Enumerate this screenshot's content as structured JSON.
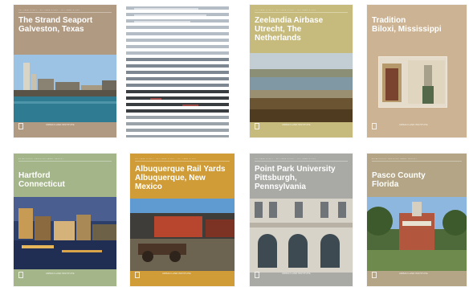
{
  "covers": [
    {
      "title": "The Strand Seaport\nGalveston, Texas",
      "series": "ULI CASE STUDY · ULI CASE STUDY · ULI CASE STUDY",
      "footer": "URBAN LAND INSTITUTE",
      "bg": "#b19a82"
    },
    {
      "title": "",
      "series": "",
      "footer": "",
      "bg": "#ffffff"
    },
    {
      "title": "Zeelandia Airbase\nUtrecht, The Netherlands",
      "series": "ULI CASE STUDY · ULI CASE STUDY · ULI CASE STUDY",
      "footer": "URBAN LAND INSTITUTE",
      "bg": "#c6ba7c"
    },
    {
      "title": "Tradition\nBiloxi, Mississippi",
      "series": "",
      "footer": "URBAN LAND INSTITUTE",
      "bg": "#cbb393"
    },
    {
      "title": "Hartford\nConnecticut",
      "series": "AN ADVISORY SERVICES PANEL REPORT",
      "footer": "URBAN LAND INSTITUTE",
      "bg": "#a4b589"
    },
    {
      "title": "Albuquerque Rail Yards\nAlbuquerque, New Mexico",
      "series": "ULI CASE STUDY · ULI CASE STUDY · ULI CASE STUDY",
      "footer": "URBAN LAND INSTITUTE",
      "bg": "#cf9c37"
    },
    {
      "title": "Point Park University\nPittsburgh, Pennsylvania",
      "series": "ULI CASE STUDY · ULI CASE STUDY · ULI CASE STUDY",
      "footer": "URBAN LAND INSTITUTE",
      "bg": "#a9a9a5"
    },
    {
      "title": "Pasco County\nFlorida",
      "series": "AN ADVISORY SERVICES PANEL REPORT",
      "footer": "URBAN LAND INSTITUTE",
      "bg": "#b3a585"
    }
  ]
}
